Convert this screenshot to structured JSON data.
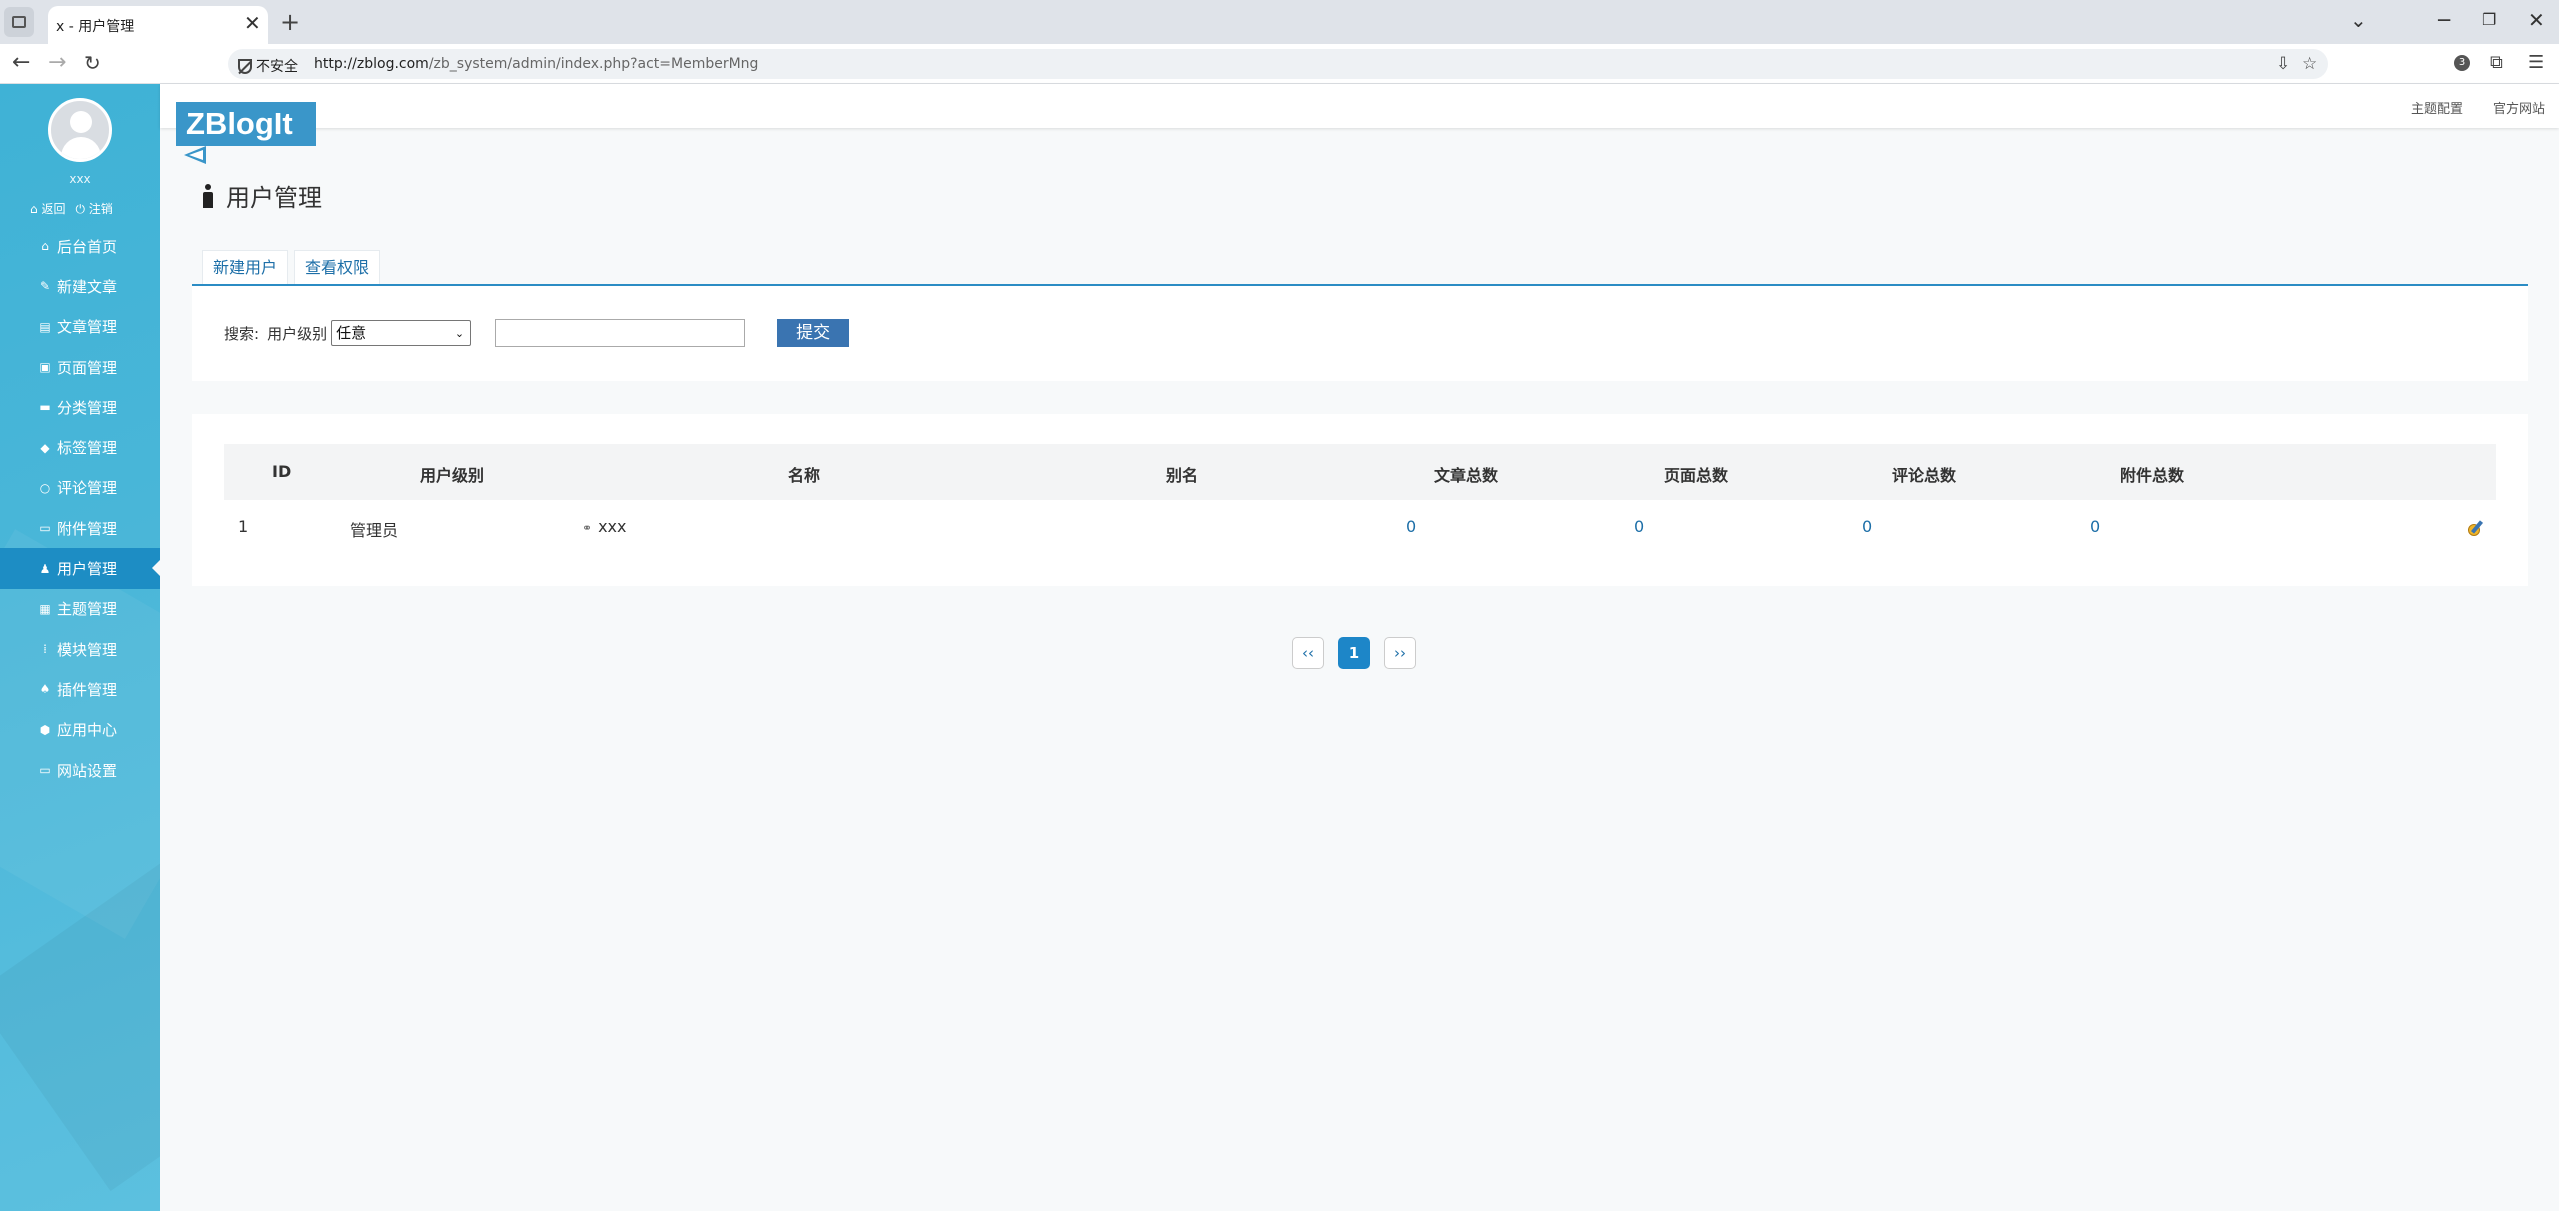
{
  "browser": {
    "tab_title": "x - 用户管理",
    "tab_close": "✕",
    "new_tab": "+",
    "insecure_label": "不安全",
    "url_scheme_host": "http://zblog.com",
    "url_path": "/zb_system/admin/index.php?act=MemberMng",
    "extension_count": "3"
  },
  "sidebar": {
    "user_name": "xxx",
    "back_label": "返回",
    "logout_label": "注销",
    "items": [
      {
        "label": "后台首页",
        "icon": "home-icon"
      },
      {
        "label": "新建文章",
        "icon": "edit-icon"
      },
      {
        "label": "文章管理",
        "icon": "document-icon"
      },
      {
        "label": "页面管理",
        "icon": "pages-icon"
      },
      {
        "label": "分类管理",
        "icon": "folder-icon"
      },
      {
        "label": "标签管理",
        "icon": "tag-icon"
      },
      {
        "label": "评论管理",
        "icon": "comment-icon"
      },
      {
        "label": "附件管理",
        "icon": "attachment-icon"
      },
      {
        "label": "用户管理",
        "icon": "person-icon",
        "active": true
      },
      {
        "label": "主题管理",
        "icon": "theme-icon"
      },
      {
        "label": "模块管理",
        "icon": "module-icon"
      },
      {
        "label": "插件管理",
        "icon": "plugin-icon"
      },
      {
        "label": "应用中心",
        "icon": "app-center-icon"
      },
      {
        "label": "网站设置",
        "icon": "settings-icon"
      }
    ]
  },
  "header": {
    "logo_text": "ZBlogIt",
    "links": [
      "主题配置",
      "官方网站"
    ]
  },
  "main": {
    "title": "用户管理",
    "tabs": [
      "新建用户",
      "查看权限"
    ],
    "search": {
      "label": "搜索:",
      "level_label": "用户级别",
      "level_selected": "任意",
      "keyword_value": "",
      "submit_label": "提交"
    },
    "table": {
      "columns": [
        "ID",
        "用户级别",
        "名称",
        "别名",
        "文章总数",
        "页面总数",
        "评论总数",
        "附件总数"
      ],
      "rows": [
        {
          "id": "1",
          "level": "管理员",
          "name": "xxx",
          "alias": "",
          "articles": "0",
          "pages": "0",
          "comments": "0",
          "attachments": "0"
        }
      ]
    },
    "pagination": {
      "prev": "‹‹",
      "current": "1",
      "next": "››"
    }
  },
  "colors": {
    "sidebar": "#44b4d7",
    "active_menu": "#1d8dc4",
    "accent": "#2b8cc4",
    "logo": "#3a96c9",
    "submit": "#3a74b1"
  }
}
